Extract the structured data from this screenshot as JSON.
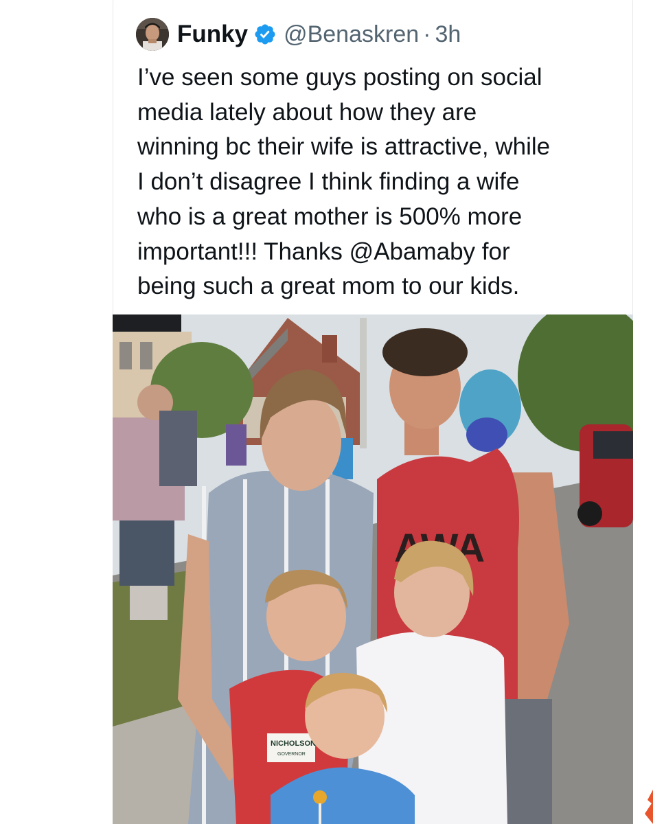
{
  "tweet": {
    "display_name": "Funky",
    "handle": "@Benaskren",
    "separator": "·",
    "time": "3h",
    "text_lines": [
      "I’ve seen some guys posting on social",
      "media lately about how they are",
      "winning bc their wife is attractive, while",
      "I don’t disagree I think finding a wife",
      "who is a great mother is 500% more",
      "important!!! Thanks @Abamaby for",
      "being such a great mom to our kids."
    ]
  },
  "photo": {
    "tank_print": "AWA",
    "sign_text": "NICHOLSON",
    "sign_subtext": "GOVERNOR"
  },
  "colors": {
    "text": "#0f1419",
    "secondary": "#536471",
    "verified": "#1d9bf0",
    "border": "#e6e8eb"
  },
  "icons": {
    "verified": "verified-badge-icon"
  }
}
